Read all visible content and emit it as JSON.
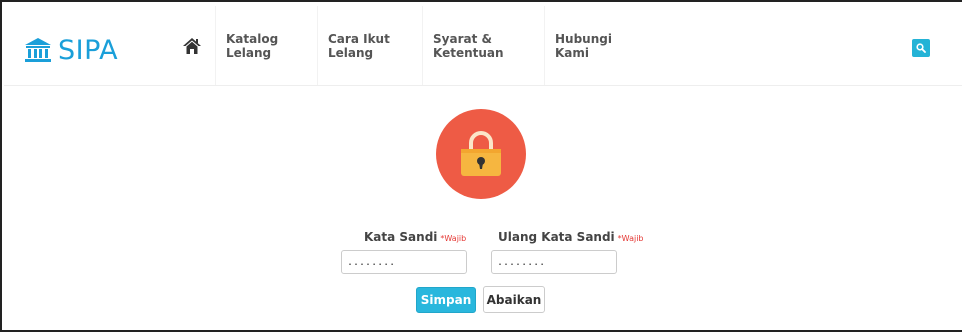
{
  "brand": {
    "name": "SIPA",
    "icon": "bank-icon"
  },
  "nav": {
    "home_icon": "home-icon",
    "items": [
      {
        "label": "Katalog Lelang"
      },
      {
        "label": "Cara Ikut Lelang"
      },
      {
        "label": "Syarat & Ketentuan"
      },
      {
        "label": "Hubungi Kami"
      }
    ],
    "search_icon": "search-icon"
  },
  "form": {
    "lock_icon": "padlock-icon",
    "password": {
      "label": "Kata Sandi",
      "required": "*Wajib",
      "value": "........"
    },
    "confirm_password": {
      "label": "Ulang Kata Sandi",
      "required": "*Wajib",
      "value": "........"
    },
    "save_label": "Simpan",
    "cancel_label": "Abaikan"
  },
  "colors": {
    "brand": "#1a9fd9",
    "accent": "#29b7dd",
    "lock_circle": "#ee5b45",
    "lock_body": "#f6b640",
    "required": "#e53935"
  }
}
